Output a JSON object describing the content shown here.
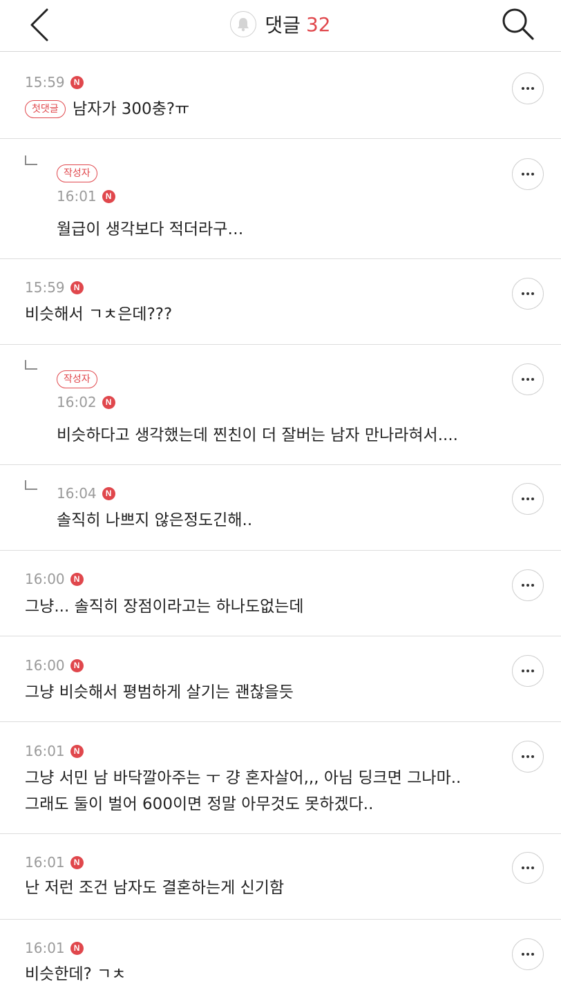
{
  "header": {
    "title": "댓글",
    "count": "32"
  },
  "colors": {
    "accent": "#e0474c",
    "divider": "#dcdcdc",
    "time": "#9a9a9a"
  },
  "icons": {
    "back": "chevron-left-icon",
    "search": "search-icon",
    "bell": "bell-icon",
    "more": "more-horizontal-icon",
    "new": "new-badge-icon"
  },
  "new_badge": "N",
  "comments": [
    {
      "time": "15:59",
      "badge": "첫댓글",
      "lines": [
        "남자가 300충?ㅠ"
      ]
    },
    {
      "time": "16:01",
      "badge": "작성자",
      "lines": [
        "월급이 생각보다 적더라구…"
      ]
    },
    {
      "time": "15:59",
      "lines": [
        "비슷해서 ㄱㅊ은데???"
      ]
    },
    {
      "time": "16:02",
      "badge": "작성자",
      "lines": [
        "비슷하다고 생각했는데 찐친이 더 잘버는 남자 만나라혀서...."
      ]
    },
    {
      "time": "16:04",
      "lines": [
        "솔직히 나쁘지 않은정도긴해.."
      ]
    },
    {
      "time": "16:00",
      "lines": [
        "그냥... 솔직히 장점이라고는 하나도없는데"
      ]
    },
    {
      "time": "16:00",
      "lines": [
        "그냥 비슷해서 평범하게 살기는 괜찮을듯"
      ]
    },
    {
      "time": "16:01",
      "lines": [
        "그냥 서민 남 바닥깔아주는 ㅜ 걍 혼자살어,,, 아님 딩크면 그나마..",
        "그래도 둘이 벌어 600이면 정말 아무것도 못하겠다.."
      ]
    },
    {
      "time": "16:01",
      "lines": [
        "난 저런 조건 남자도 결혼하는게 신기함"
      ]
    },
    {
      "time": "16:01",
      "lines": [
        "비슷한데? ㄱㅊ"
      ]
    }
  ]
}
